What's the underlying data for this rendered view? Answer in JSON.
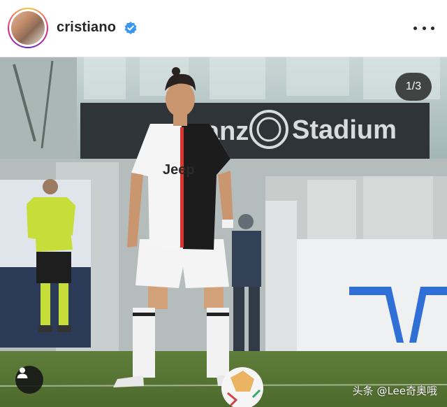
{
  "post": {
    "username": "cristiano",
    "verified": true,
    "verified_icon": "verified-badge-icon",
    "more_icon": "more-options-icon"
  },
  "media": {
    "counter": "1/3",
    "tag_icon": "user-tag-icon",
    "stadium_sign": "Stadium",
    "stadium_sign_partial": "anz",
    "jersey_sponsor": "Jeep",
    "watermark": "头条 @Lee奇奥哦"
  },
  "colors": {
    "verified_blue": "#3897f0",
    "text_dark": "#262626"
  }
}
